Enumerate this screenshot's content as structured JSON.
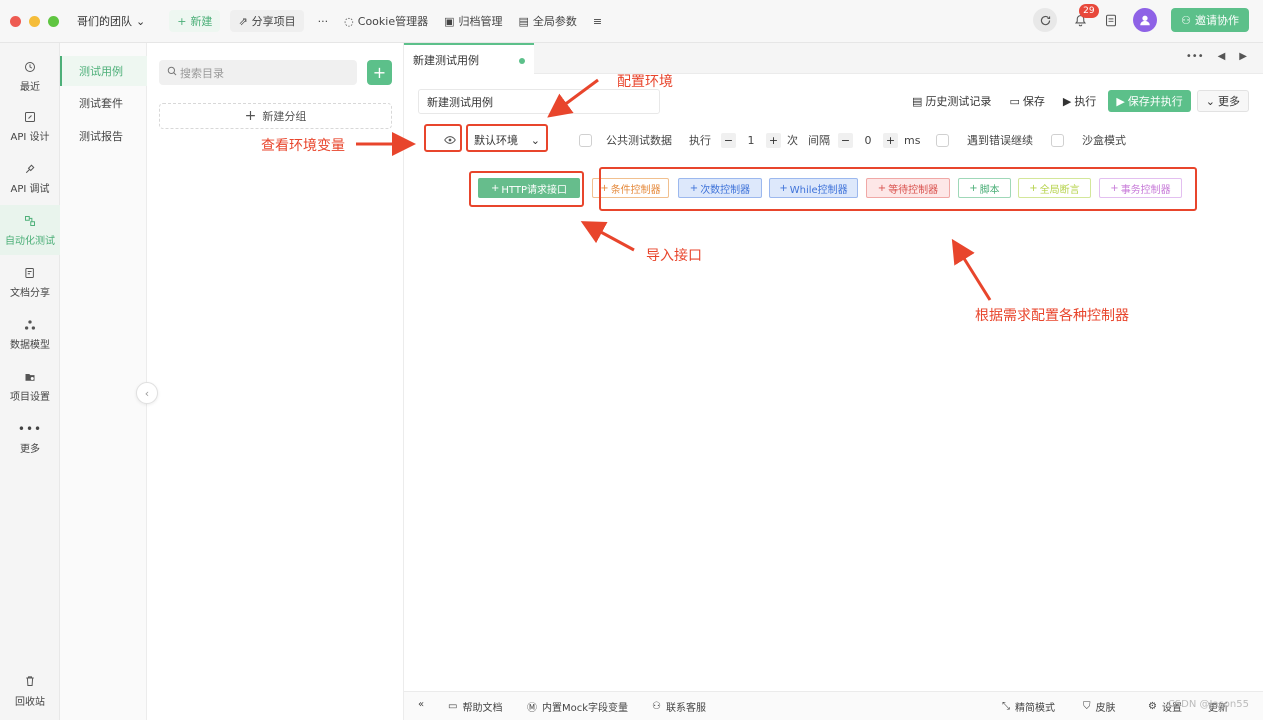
{
  "titlebar": {
    "team": "哥们的团队",
    "new": "新建",
    "share": "分享项目",
    "more": "···",
    "cookie": "Cookie管理器",
    "archive": "归档管理",
    "global_params": "全局参数",
    "notif_count": "29",
    "invite": "邀请协作",
    "colors": {
      "close": "#ee5b52",
      "min": "#f5bd3a",
      "max": "#5fc541",
      "accent": "#5cc08a"
    }
  },
  "leftnav": [
    {
      "icon": "clock-icon",
      "label": "最近"
    },
    {
      "icon": "api-design-icon",
      "label": "API 设计"
    },
    {
      "icon": "api-debug-icon",
      "label": "API 调试"
    },
    {
      "icon": "automation-icon",
      "label": "自动化测试"
    },
    {
      "icon": "doc-share-icon",
      "label": "文档分享"
    },
    {
      "icon": "data-model-icon",
      "label": "数据模型"
    },
    {
      "icon": "project-settings-icon",
      "label": "项目设置"
    },
    {
      "icon": "more-icon",
      "label": "更多"
    }
  ],
  "trash": "回收站",
  "subnav": [
    "测试用例",
    "测试套件",
    "测试报告"
  ],
  "tree": {
    "search_placeholder": "搜索目录",
    "new_group": "新建分组"
  },
  "tab": {
    "label": "新建测试用例"
  },
  "case": {
    "name": "新建测试用例",
    "toolbar": {
      "history": "历史测试记录",
      "save": "保存",
      "run": "执行",
      "save_run": "保存并执行",
      "more": "更多"
    }
  },
  "settings": {
    "env": "默认环境",
    "public_data": "公共测试数据",
    "run_label": "执行",
    "run_count": "1",
    "times": "次",
    "interval_label": "间隔",
    "interval_value": "0",
    "ms": "ms",
    "continue_on_error": "遇到错误继续",
    "sandbox": "沙盒模式"
  },
  "controllers": [
    {
      "label": "HTTP请求接口",
      "bg": "#66bd8c",
      "fg": "#ffffff",
      "border": "#66bd8c"
    },
    {
      "label": "条件控制器",
      "bg": "#ffffff",
      "fg": "#e58a3c",
      "border": "#f1c08f"
    },
    {
      "label": "次数控制器",
      "bg": "#dde8fb",
      "fg": "#3f73d9",
      "border": "#9cb8ee"
    },
    {
      "label": "While控制器",
      "bg": "#dde8fb",
      "fg": "#3f73d9",
      "border": "#9cb8ee"
    },
    {
      "label": "等待控制器",
      "bg": "#fde7e7",
      "fg": "#d9534f",
      "border": "#f0a8a6"
    },
    {
      "label": "脚本",
      "bg": "#ffffff",
      "fg": "#4caf78",
      "border": "#9fd8b8"
    },
    {
      "label": "全局断言",
      "bg": "#ffffff",
      "fg": "#b5d24a",
      "border": "#d3e79a"
    },
    {
      "label": "事务控制器",
      "bg": "#ffffff",
      "fg": "#c77ad8",
      "border": "#e3bff0"
    }
  ],
  "annotations": {
    "config_env": "配置环境",
    "view_env_vars": "查看环境变量",
    "import_api": "导入接口",
    "config_controllers": "根据需求配置各种控制器",
    "color": "#e8452c"
  },
  "statusbar": {
    "help": "帮助文档",
    "mock": "内置Mock字段变量",
    "support": "联系客服",
    "simple": "精简模式",
    "skin": "皮肤",
    "settings": "设置",
    "update": "更新",
    "watermark": "CSDN @Jason55"
  }
}
